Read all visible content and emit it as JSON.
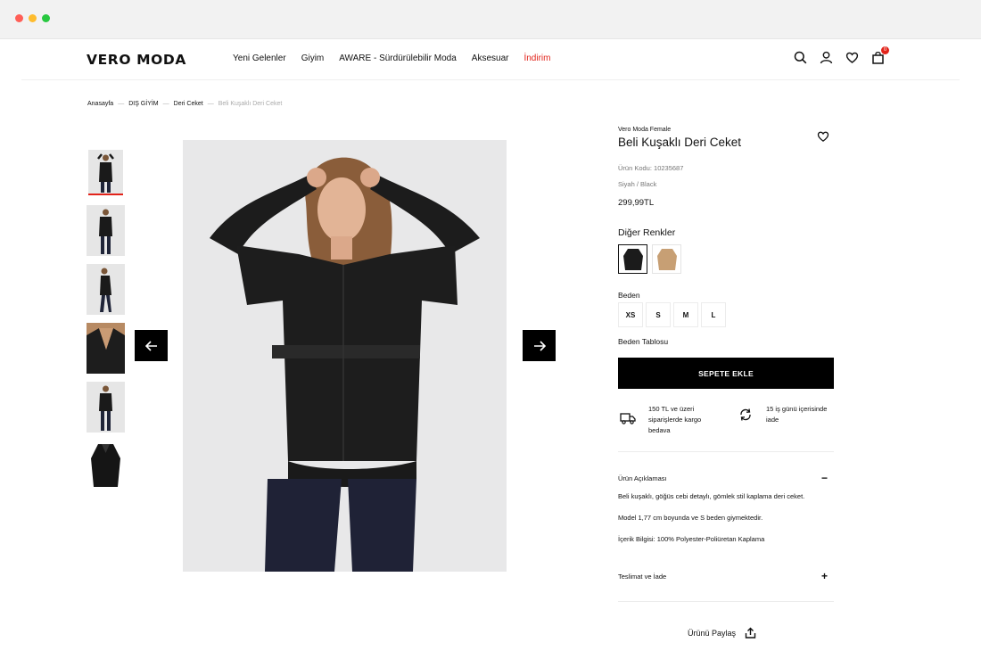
{
  "colors": {
    "accent": "#e2231a",
    "dark": "#111111",
    "dot_red": "#ff5f57",
    "dot_yellow": "#febc2e",
    "dot_green": "#28c840"
  },
  "header": {
    "logo": "VERO MODA",
    "nav": [
      "Yeni Gelenler",
      "Giyim",
      "AWARE - Sürdürülebilir Moda",
      "Aksesuar",
      "İndirim"
    ],
    "icons": [
      "search-icon",
      "account-icon",
      "heart-icon",
      "bag-icon"
    ],
    "cart_count": "0"
  },
  "breadcrumb": [
    "Anasayfa",
    "DIŞ GİYİM",
    "Deri Ceket",
    "Beli Kuşaklı Deri Ceket"
  ],
  "gallery": {
    "thumbnail_count": 6,
    "active_index": 0
  },
  "product": {
    "brand": "Vero Moda Female",
    "title": "Beli Kuşaklı Deri Ceket",
    "code": "Ürün Kodu: 10235687",
    "color": "Siyah / Black",
    "price": "299,99TL",
    "other_colors_label": "Diğer Renkler",
    "swatches": [
      {
        "name": "black",
        "hex": "#1b1b1b",
        "selected": true
      },
      {
        "name": "camel",
        "hex": "#c79f74",
        "selected": false
      }
    ],
    "size_label": "Beden",
    "sizes": [
      "XS",
      "S",
      "M",
      "L"
    ],
    "size_chart": "Beden Tablosu",
    "add_to_cart": "SEPETE EKLE",
    "shipping": "150 TL ve üzeri siparişlerde kargo bedava",
    "returns": "15 iş günü içerisinde iade",
    "description_title": "Ürün Açıklaması",
    "description_sign": "−",
    "description": [
      "Beli kuşaklı, göğüs cebi detaylı, gömlek stil kaplama deri ceket.",
      "Model 1,77 cm boyunda ve S beden giymektedir.",
      "İçerik Bilgisi: 100% Polyester-Poliüretan Kaplama"
    ],
    "delivery_title": "Teslimat ve İade",
    "delivery_sign": "+",
    "share": "Ürünü Paylaş"
  }
}
